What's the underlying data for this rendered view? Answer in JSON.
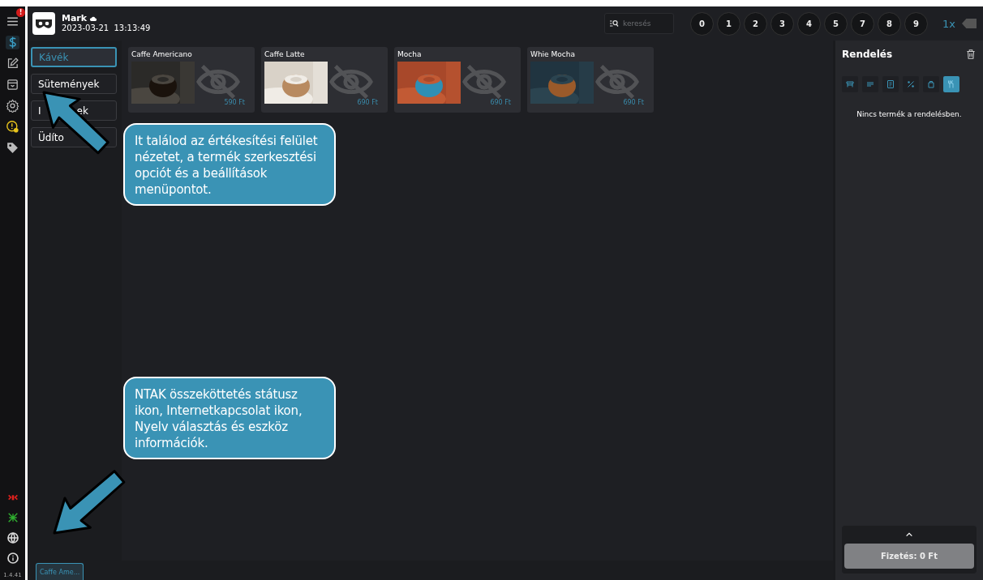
{
  "sidebar": {
    "top": [
      {
        "kind": "menu",
        "selected": false,
        "badge": "!"
      },
      {
        "kind": "dollar",
        "selected": true
      },
      {
        "kind": "edit",
        "selected": false
      },
      {
        "kind": "box",
        "selected": false
      },
      {
        "kind": "gear",
        "selected": false
      },
      {
        "kind": "alert",
        "selected": false
      },
      {
        "kind": "tag",
        "selected": false
      }
    ],
    "bottom": [
      {
        "kind": "signal",
        "color": "#e0211d"
      },
      {
        "kind": "network",
        "color": "#2fae2f"
      },
      {
        "kind": "globe",
        "color": "#d8d8d8"
      },
      {
        "kind": "info",
        "color": "#d8d8d8"
      }
    ],
    "version": "1.4.41"
  },
  "header": {
    "user": "Mark",
    "datetime": "2023-03-21  13:13:49",
    "search": {
      "placeholder": "keresés"
    },
    "digits": [
      "0",
      "1",
      "2",
      "3",
      "4",
      "5",
      "7",
      "8",
      "9"
    ],
    "multiplier": "1x"
  },
  "categories": [
    {
      "label": "Kávék",
      "selected": true
    },
    {
      "label": "Sütemények",
      "selected": false
    },
    {
      "label": "I",
      "label_end": "ek",
      "selected": false
    },
    {
      "label": "Üdíto",
      "selected": false
    }
  ],
  "products": [
    {
      "name": "Caffe Americano",
      "price": "590 Ft"
    },
    {
      "name": "Caffe Latte",
      "price": "690 Ft"
    },
    {
      "name": "Mocha",
      "price": "690 Ft"
    },
    {
      "name": "Whie Mocha",
      "price": "690 Ft"
    }
  ],
  "order": {
    "title": "Rendelés",
    "modes": [
      {
        "kind": "table",
        "selected": false
      },
      {
        "kind": "lines",
        "selected": false
      },
      {
        "kind": "receipt",
        "selected": false
      },
      {
        "kind": "percent",
        "selected": false
      },
      {
        "kind": "bag",
        "selected": false
      },
      {
        "kind": "cutlery",
        "selected": true
      }
    ],
    "empty_text": "Nincs termék a rendelésben.",
    "pay_button": "Fizetés: 0 Ft"
  },
  "bottom_bar": {
    "chips": [
      "Caffe Ame..."
    ]
  },
  "callouts": [
    {
      "text": "It találod az értékesítési felület nézetet, a termék szerkesztési opciót és a beállítások menüpontot."
    },
    {
      "text": "NTAK összeköttetés státusz ikon, Internetkapcsolat ikon, Nyelv választás és eszköz információk."
    }
  ]
}
